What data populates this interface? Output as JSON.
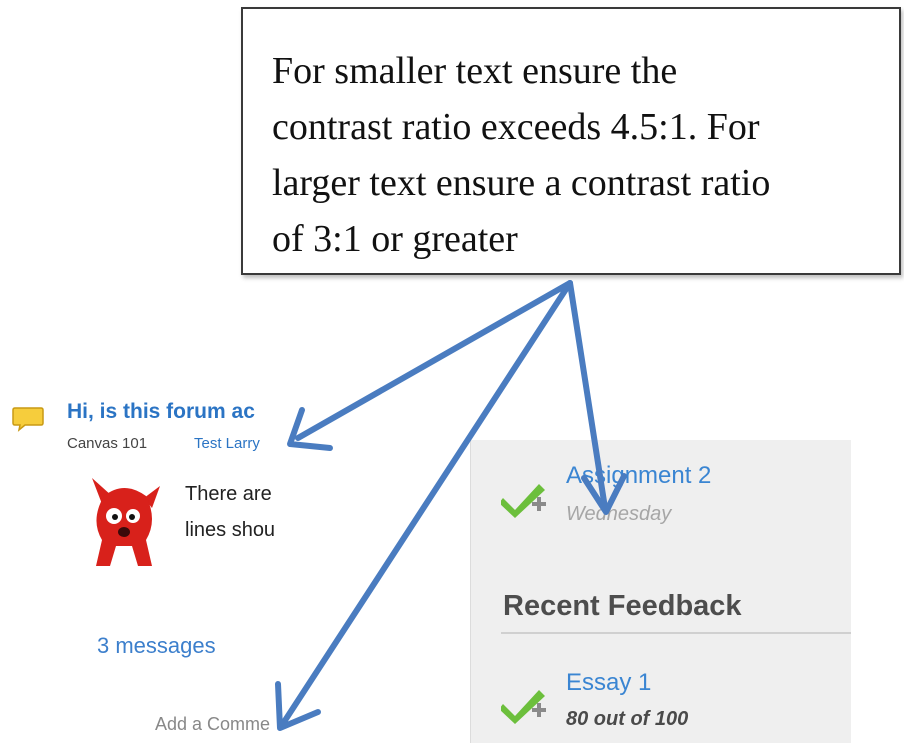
{
  "callout": {
    "lines": [
      "For smaller text ensure the",
      "contrast ratio exceeds 4.5:1. For",
      "larger text ensure a contrast ratio",
      "of 3:1 or greater"
    ]
  },
  "discussion": {
    "title": "Hi, is this forum ac",
    "course": "Canvas 101",
    "author": "Test Larry",
    "body_lines": [
      "There are",
      "lines shou"
    ],
    "message_count": "3 messages",
    "add_comment": "Add a Comme"
  },
  "sidebar": {
    "assignment": {
      "title": "Assignment 2",
      "due": "Wednesday"
    },
    "recent_feedback_heading": "Recent Feedback",
    "feedback": {
      "title": "Essay 1",
      "score": "80 out of 100"
    }
  },
  "colors": {
    "link": "#2b74c4",
    "arrow": "#4a7cc0",
    "check": "#6cbf3c",
    "muted": "#a6a6a6",
    "panel": "#efefef"
  }
}
